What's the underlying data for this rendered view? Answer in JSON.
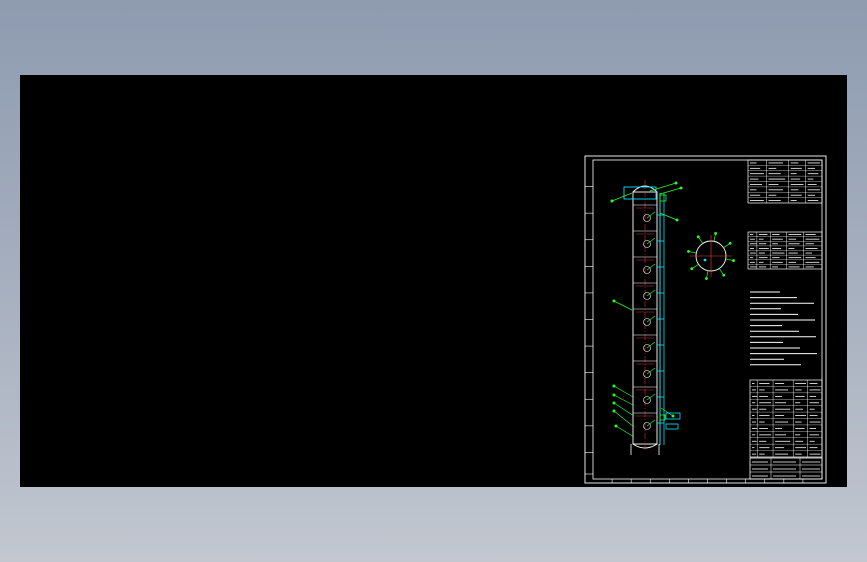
{
  "viewer": {
    "background_color": "#000000",
    "colors": {
      "frame": "#ffffff",
      "vessel": "#ffffff",
      "centerline": "#ff3b3b",
      "piping": "#00e5ff",
      "annotation": "#22ff22",
      "accent": "#ffff00"
    }
  },
  "drawing": {
    "zone_rows": 12,
    "zone_columns": 12,
    "tray_count": 9,
    "nozzle_count": 8,
    "top_leaders": 4,
    "bottom_leaders": 6,
    "notes_lines": 14
  }
}
